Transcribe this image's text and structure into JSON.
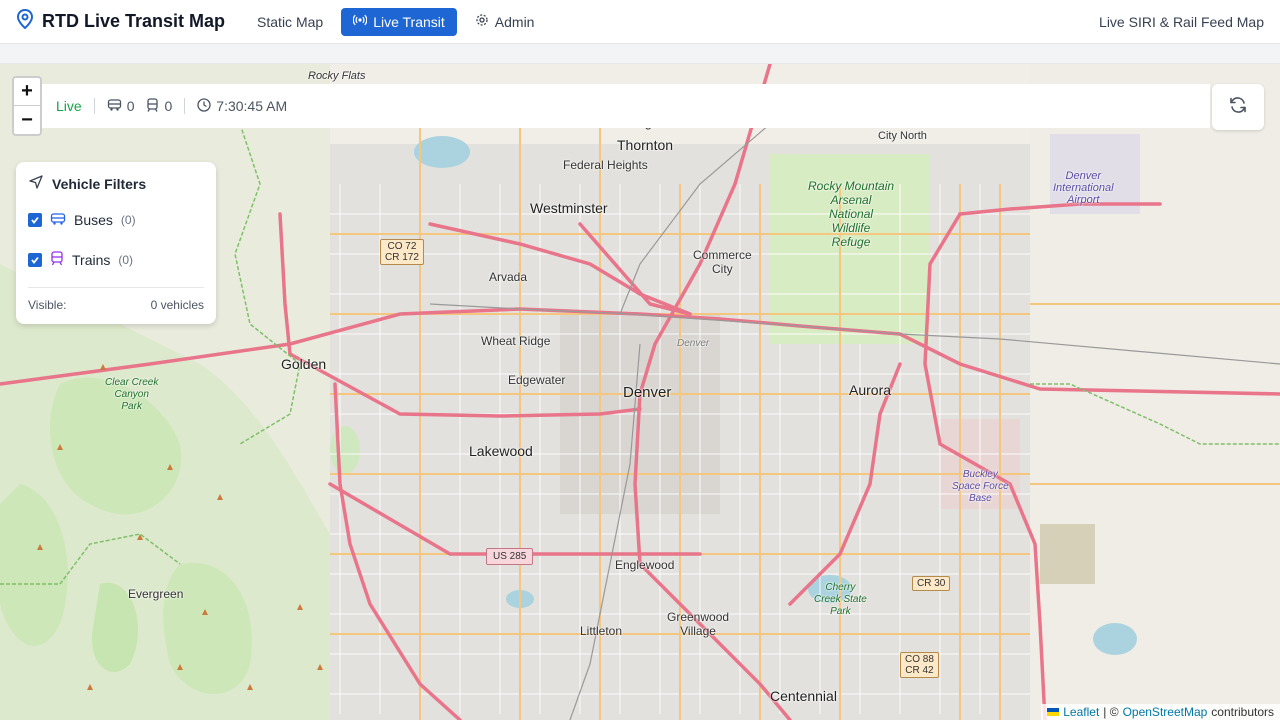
{
  "header": {
    "title": "RTD Live Transit Map",
    "nav": [
      {
        "label": "Static Map",
        "active": false
      },
      {
        "label": "Live Transit",
        "active": true
      },
      {
        "label": "Admin",
        "active": false
      }
    ],
    "right_title": "Live SIRI & Rail Feed Map"
  },
  "status": {
    "live_label": "Live",
    "bus_count": "0",
    "train_count": "0",
    "time": "7:30:45 AM"
  },
  "filters": {
    "title": "Vehicle Filters",
    "items": [
      {
        "label": "Buses",
        "count": "(0)",
        "checked": true
      },
      {
        "label": "Trains",
        "count": "(0)",
        "checked": true
      }
    ],
    "visible_label": "Visible:",
    "visible_value": "0 vehicles"
  },
  "map": {
    "cities": [
      "Denver",
      "Aurora",
      "Lakewood",
      "Westminster",
      "Thornton",
      "Arvada",
      "Golden",
      "Wheat Ridge",
      "Edgewater",
      "Englewood",
      "Littleton",
      "Greenwood Village",
      "Centennial",
      "Evergreen",
      "Commerce City",
      "Federal Heights",
      "Northglenn",
      "City North",
      "Rocky Flats"
    ],
    "parks": [
      "Rocky Mountain Arsenal National Wildlife Refuge",
      "Clear Creek Canyon Park",
      "Cherry Creek State Park"
    ],
    "airports": [
      "Denver International Airport",
      "Buckley Space Force Base"
    ],
    "shields": [
      "CO 72 CR 172",
      "US 285",
      "CR 30",
      "CO 88 CR 42"
    ]
  },
  "attribution": {
    "leaflet": "Leaflet",
    "separator": "| ©",
    "osm": "OpenStreetMap",
    "contributors": "contributors"
  },
  "colors": {
    "accent": "#1d66d4",
    "live": "#16a34a",
    "highway": "#e8758a",
    "road": "#f5c77e"
  }
}
